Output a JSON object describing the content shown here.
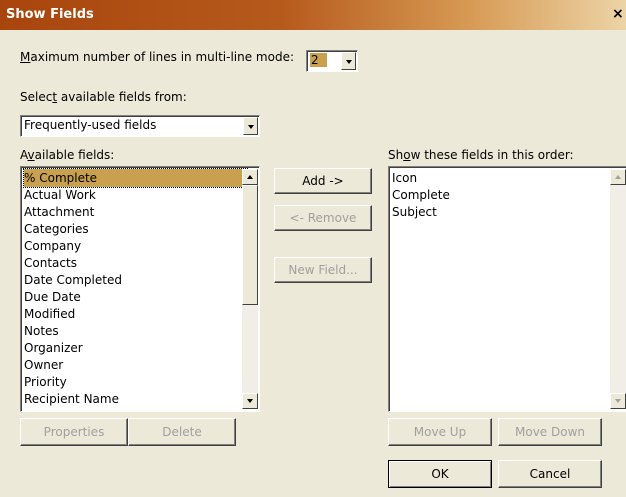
{
  "window": {
    "title": "Show Fields",
    "close": "×"
  },
  "max_lines": {
    "label": "Maximum number of lines in multi-line mode:",
    "value": "2"
  },
  "select_from": {
    "label": "Select available fields from:",
    "value": "Frequently-used fields"
  },
  "available": {
    "label": "Available fields:",
    "items": [
      "% Complete",
      "Actual Work",
      "Attachment",
      "Categories",
      "Company",
      "Contacts",
      "Date Completed",
      "Due Date",
      "Modified",
      "Notes",
      "Organizer",
      "Owner",
      "Priority",
      "Recipient Name"
    ],
    "selected_index": 0
  },
  "shown": {
    "label": "Show these fields in this order:",
    "items": [
      "Icon",
      "Complete",
      "Subject"
    ]
  },
  "buttons": {
    "add": "Add ->",
    "remove": "<- Remove",
    "new_field": "New Field...",
    "properties": "Properties",
    "delete": "Delete",
    "move_up": "Move Up",
    "move_down": "Move Down",
    "ok": "OK",
    "cancel": "Cancel"
  }
}
